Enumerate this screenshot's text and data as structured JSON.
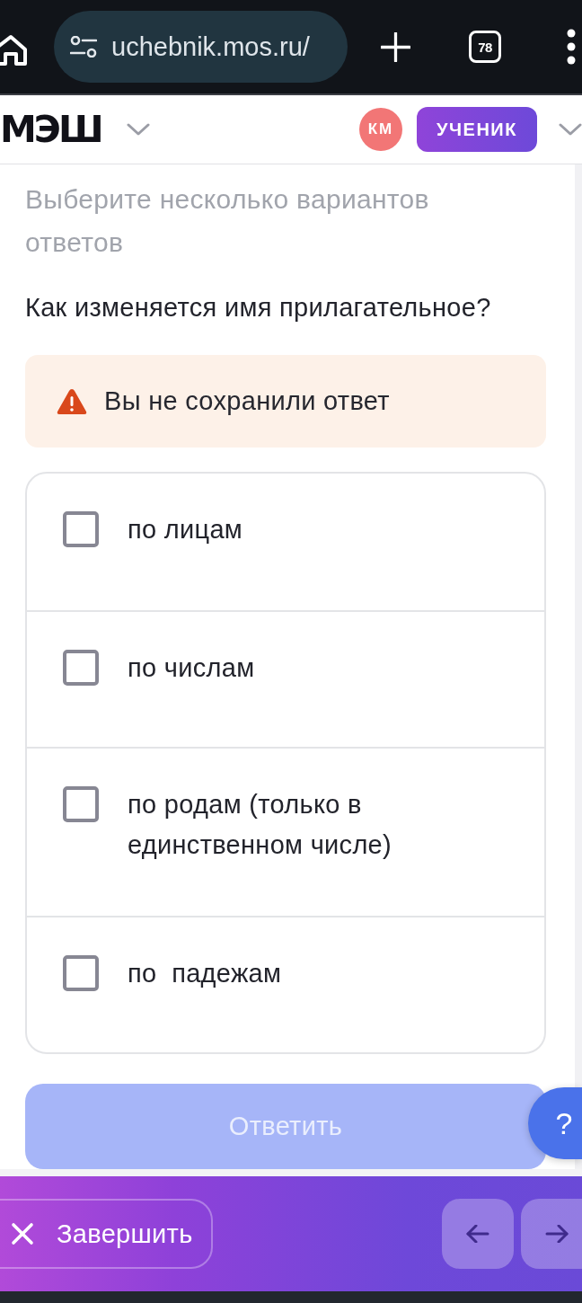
{
  "browser": {
    "url": "uchebnik.mos.ru/",
    "tab_count": "78"
  },
  "header": {
    "logo": "МЭШ",
    "avatar_initials": "КМ",
    "role": "УЧЕНИК"
  },
  "task": {
    "hint": "Выберите несколько вариантов ответов",
    "question": "Как изменяется имя прилагательное?",
    "warning": "Вы не сохранили ответ"
  },
  "options": [
    {
      "label": "по лицам",
      "checked": false
    },
    {
      "label": "по числам",
      "checked": false
    },
    {
      "label": "по родам (только в единственном числе)",
      "checked": false
    },
    {
      "label": "по  падежам",
      "checked": false
    }
  ],
  "answer_button": {
    "label": "Ответить",
    "disabled": true
  },
  "help_button": {
    "label": "?"
  },
  "footer": {
    "finish_label": "Завершить"
  }
}
